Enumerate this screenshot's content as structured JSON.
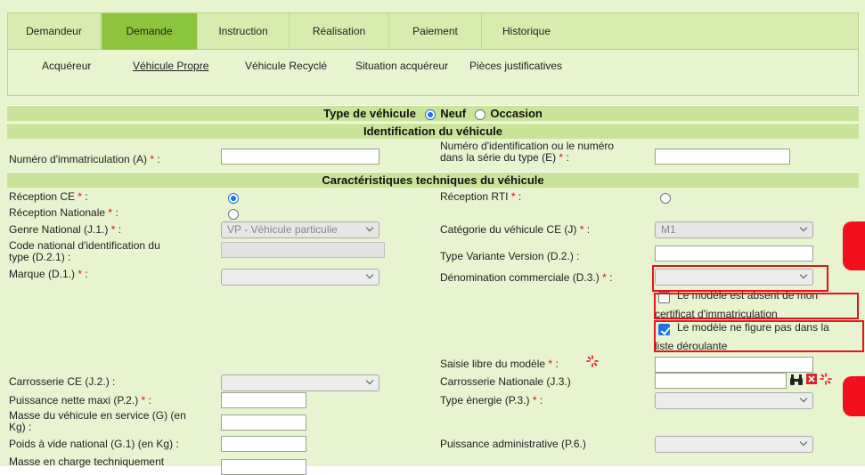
{
  "tabs": [
    {
      "label": "Demandeur"
    },
    {
      "label": "Demande",
      "active": true
    },
    {
      "label": "Instruction"
    },
    {
      "label": "Réalisation"
    },
    {
      "label": "Paiement"
    },
    {
      "label": "Historique"
    }
  ],
  "subnav": [
    {
      "label": "Acquéreur"
    },
    {
      "label": "Véhicule Propre",
      "active": true
    },
    {
      "label": "Véhicule Recyclé"
    },
    {
      "label": "Situation acquéreur"
    },
    {
      "label": "Pièces justificatives"
    }
  ],
  "type_vehicule": {
    "label": "Type de véhicule",
    "options": [
      "Neuf",
      "Occasion"
    ],
    "selected": "Neuf"
  },
  "section_identification": "Identification du véhicule",
  "section_caracteristiques": "Caractéristiques techniques du véhicule",
  "fields": {
    "numero_immatriculation": {
      "label": "Numéro d'immatriculation (A)",
      "value": ""
    },
    "numero_identification": {
      "label_line1": "Numéro d'identification ou le numéro",
      "label_line2": "dans la série du type (E)",
      "value": ""
    },
    "reception_ce": {
      "label": "Réception CE",
      "checked": true
    },
    "reception_nationale": {
      "label": "Réception Nationale",
      "checked": false
    },
    "reception_rti": {
      "label": "Réception RTI",
      "checked": false
    },
    "genre_national": {
      "label": "Genre National (J.1.)",
      "value": "VP - Véhicule particulie"
    },
    "categorie_ce": {
      "label": "Catégorie du véhicule CE (J)",
      "value": "M1"
    },
    "code_national": {
      "label_line1": "Code national d'identification du",
      "label_line2": "type (D.2.1) :",
      "value": ""
    },
    "type_variante": {
      "label": "Type Variante Version (D.2.) :",
      "value": ""
    },
    "marque": {
      "label": "Marque (D.1.)",
      "value": ""
    },
    "denomination": {
      "label": "Dénomination commerciale (D.3.)",
      "value": ""
    },
    "modele_absent": {
      "label_line1": "Le modèle est absent de mon",
      "label_line2": "certificat d'immatriculation",
      "checked": false
    },
    "modele_non_liste": {
      "label_line1": "Le modèle ne figure pas dans la",
      "label_line2": "liste déroulante",
      "checked": true
    },
    "saisie_libre": {
      "label": "Saisie libre du modèle",
      "value": ""
    },
    "carrosserie_ce": {
      "label": "Carrosserie CE (J.2.) :",
      "value": ""
    },
    "carrosserie_nationale": {
      "label": "Carrosserie Nationale (J.3.)",
      "value": ""
    },
    "puissance_nette": {
      "label": "Puissance nette maxi (P.2.)",
      "value": ""
    },
    "type_energie": {
      "label": "Type énergie (P.3.)",
      "value": ""
    },
    "masse_service": {
      "label_line1": "Masse du véhicule en service (G) (en",
      "label_line2": "Kg) :",
      "value": ""
    },
    "poids_vide": {
      "label": "Poids à vide national (G.1) (en Kg) :",
      "value": ""
    },
    "puissance_admin": {
      "label": "Puissance administrative (P.6.)",
      "value": ""
    },
    "masse_charge": {
      "label": "Masse en charge techniquement",
      "value": ""
    }
  },
  "required_marker": "*",
  "colon": ":",
  "colors": {
    "accent": "#8cc43e",
    "highlight": "#e8111b",
    "radio": "#1a73e8"
  }
}
